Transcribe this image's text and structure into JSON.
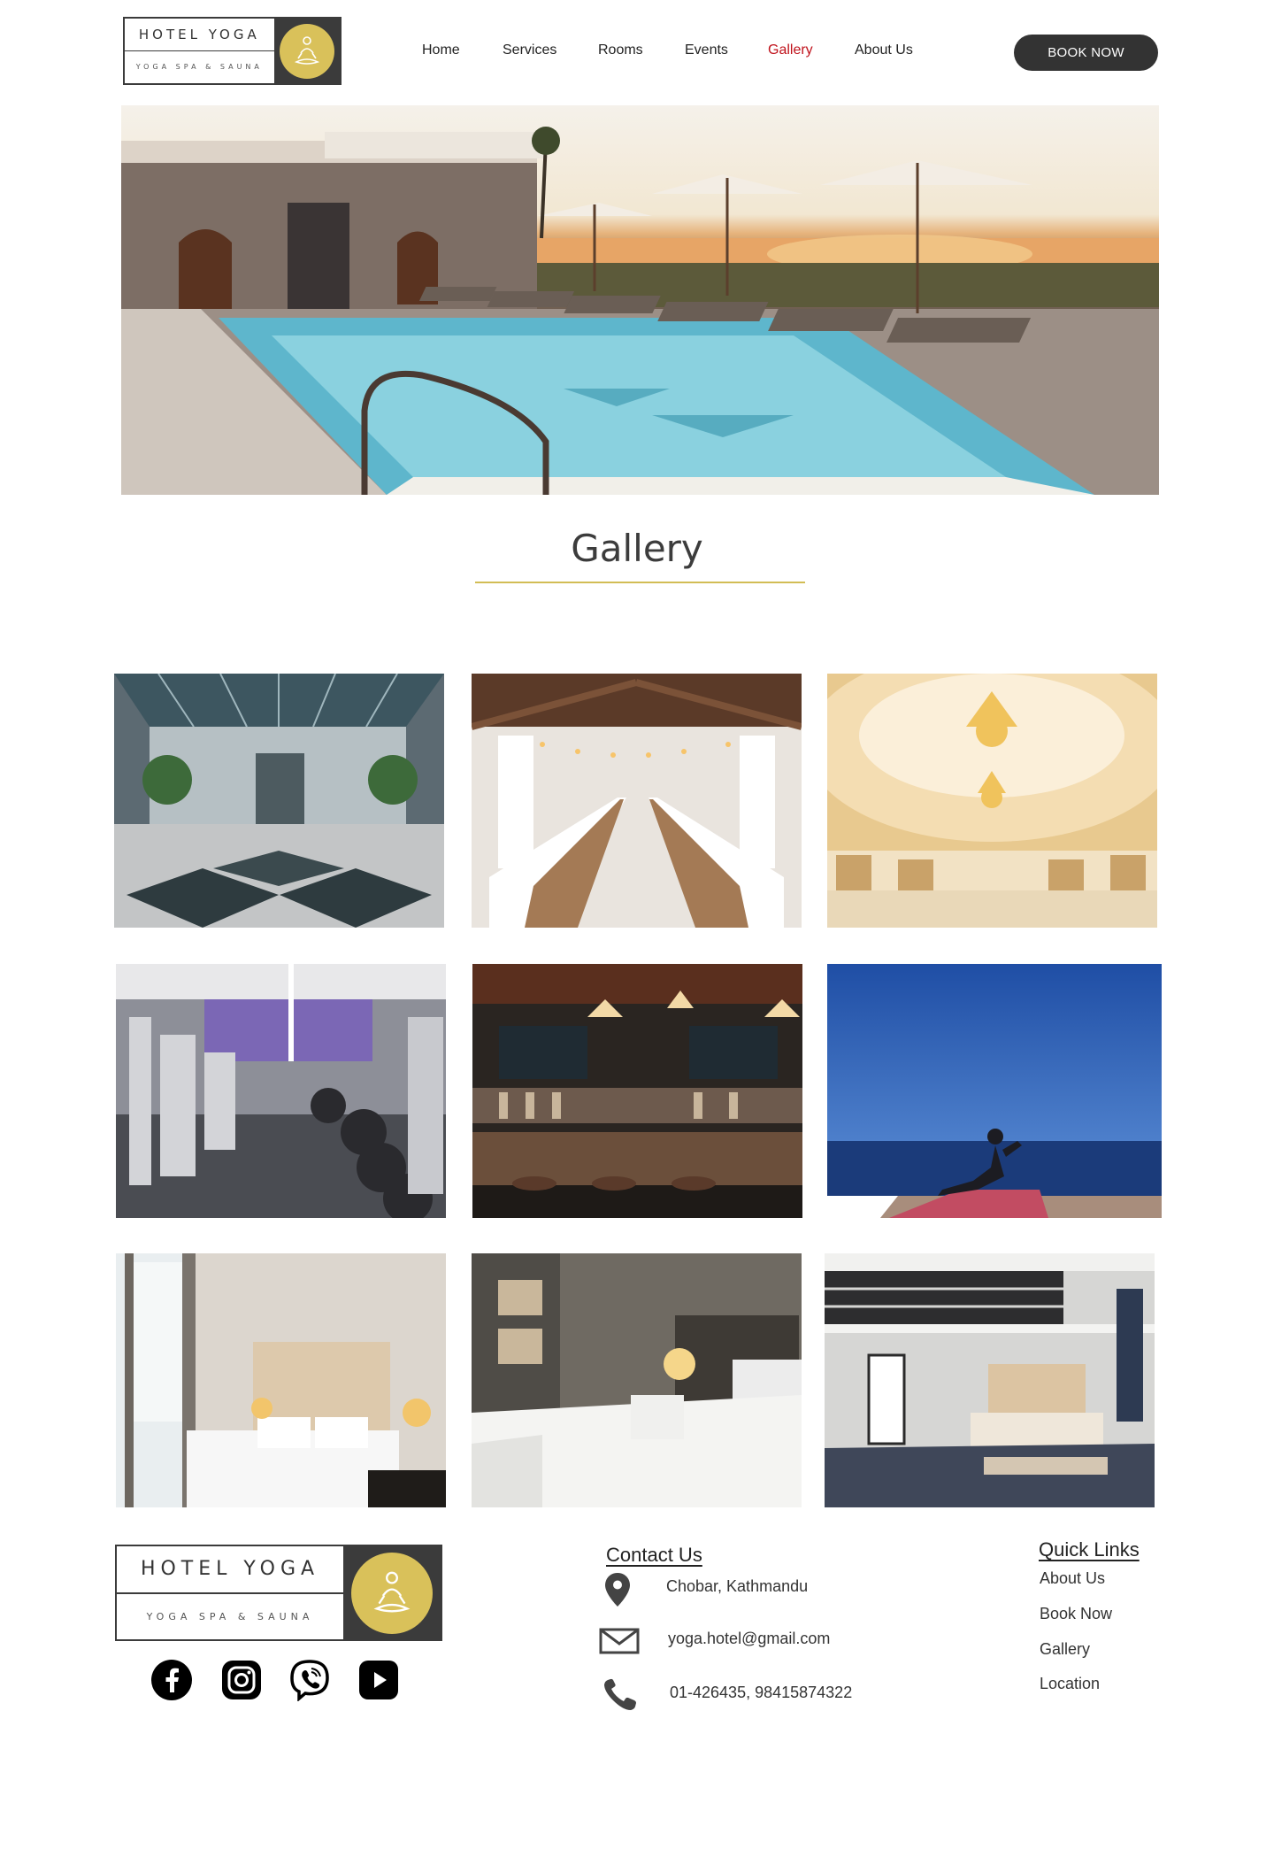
{
  "brand": {
    "name": "HOTEL YOGA",
    "tagline": "YOGA SPA & SAUNA",
    "badge_color": "#d9c15a",
    "dark_color": "#333333",
    "icon": "yoga-meditation-icon"
  },
  "nav": {
    "items": [
      {
        "label": "Home"
      },
      {
        "label": "Services"
      },
      {
        "label": "Rooms"
      },
      {
        "label": "Events"
      },
      {
        "label": "Gallery",
        "active": true
      },
      {
        "label": "About Us"
      }
    ],
    "active_color": "#c0121b",
    "cta": "BOOK NOW"
  },
  "hero": {
    "alt": "rooftop pool with loungers and umbrellas at sunset"
  },
  "gallery": {
    "title": "Gallery",
    "rule_color": "#d2bd55",
    "images": [
      {
        "subject": "grand lobby with glass dome ceiling"
      },
      {
        "subject": "banquet hall with long tables and string lights"
      },
      {
        "subject": "ballroom with chandeliers"
      },
      {
        "subject": "gym with weight machines"
      },
      {
        "subject": "bar with hanging lamps"
      },
      {
        "subject": "yoga pose by the ocean"
      },
      {
        "subject": "bedroom with tufted headboard"
      },
      {
        "subject": "bedroom with white bedding and lamp"
      },
      {
        "subject": "loft bedroom with mezzanine"
      }
    ]
  },
  "footer": {
    "social": [
      {
        "icon": "facebook-icon"
      },
      {
        "icon": "instagram-icon"
      },
      {
        "icon": "viber-icon"
      },
      {
        "icon": "youtube-icon"
      }
    ],
    "contact": {
      "heading": "Contact Us",
      "address": "Chobar, Kathmandu",
      "email": "yoga.hotel@gmail.com",
      "phone": "01-426435, 98415874322"
    },
    "quick_links": {
      "heading": "Quick Links",
      "items": [
        "About Us",
        "Book Now",
        "Gallery",
        "Location"
      ]
    }
  }
}
